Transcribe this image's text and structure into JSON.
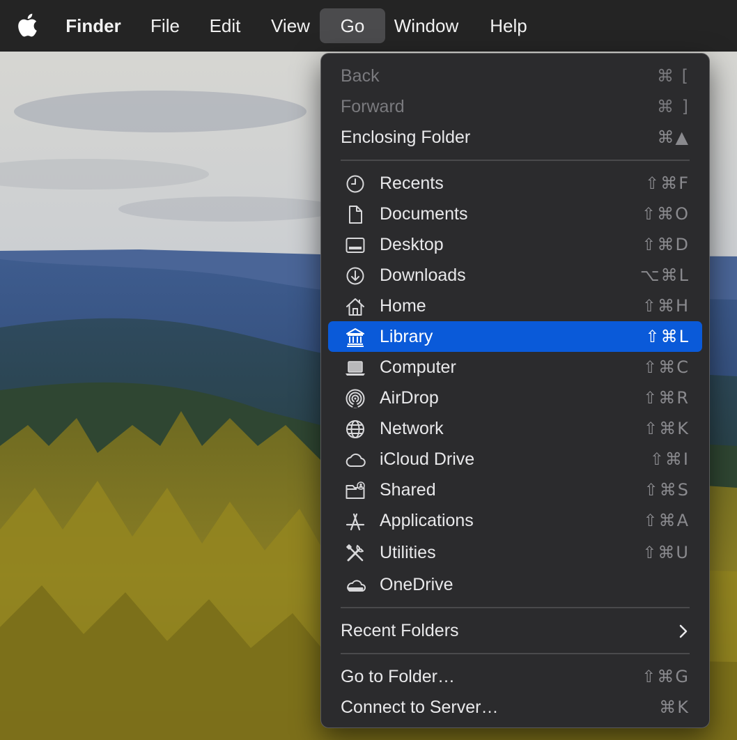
{
  "menubar": {
    "items": [
      {
        "label": "Finder"
      },
      {
        "label": "File"
      },
      {
        "label": "Edit"
      },
      {
        "label": "View"
      },
      {
        "label": "Go"
      },
      {
        "label": "Window"
      },
      {
        "label": "Help"
      }
    ],
    "open_menu": "Go"
  },
  "go_menu": {
    "nav": [
      {
        "label": "Back",
        "shortcut": "⌘ [",
        "enabled": false
      },
      {
        "label": "Forward",
        "shortcut": "⌘ ]",
        "enabled": false
      },
      {
        "label": "Enclosing Folder",
        "shortcut": "⌘▲",
        "enabled": true
      }
    ],
    "places": [
      {
        "label": "Recents",
        "shortcut": "⇧⌘F",
        "icon": "clock-icon"
      },
      {
        "label": "Documents",
        "shortcut": "⇧⌘O",
        "icon": "document-icon"
      },
      {
        "label": "Desktop",
        "shortcut": "⇧⌘D",
        "icon": "desktop-icon"
      },
      {
        "label": "Downloads",
        "shortcut": "⌥⌘L",
        "icon": "download-icon"
      },
      {
        "label": "Home",
        "shortcut": "⇧⌘H",
        "icon": "home-icon"
      },
      {
        "label": "Library",
        "shortcut": "⇧⌘L",
        "icon": "library-icon",
        "selected": true
      },
      {
        "label": "Computer",
        "shortcut": "⇧⌘C",
        "icon": "laptop-icon"
      },
      {
        "label": "AirDrop",
        "shortcut": "⇧⌘R",
        "icon": "airdrop-icon"
      },
      {
        "label": "Network",
        "shortcut": "⇧⌘K",
        "icon": "globe-icon"
      },
      {
        "label": "iCloud Drive",
        "shortcut": "⇧⌘I",
        "icon": "cloud-icon"
      },
      {
        "label": "Shared",
        "shortcut": "⇧⌘S",
        "icon": "shared-folder-icon"
      },
      {
        "label": "Applications",
        "shortcut": "⇧⌘A",
        "icon": "applications-icon"
      },
      {
        "label": "Utilities",
        "shortcut": "⇧⌘U",
        "icon": "utilities-icon"
      },
      {
        "label": "OneDrive",
        "shortcut": "",
        "icon": "onedrive-cloud-icon"
      }
    ],
    "recent_folders": {
      "label": "Recent Folders",
      "icon": "chevron-right-icon"
    },
    "actions": [
      {
        "label": "Go to Folder…",
        "shortcut": "⇧⌘G"
      },
      {
        "label": "Connect to Server…",
        "shortcut": "⌘K"
      }
    ]
  },
  "colors": {
    "menubar_bg": "#242424",
    "menu_bg": "#2b2b2d",
    "selection": "#0a5ad9",
    "disabled_text": "#7a7a7e",
    "shortcut_text": "#8a8a8e"
  }
}
